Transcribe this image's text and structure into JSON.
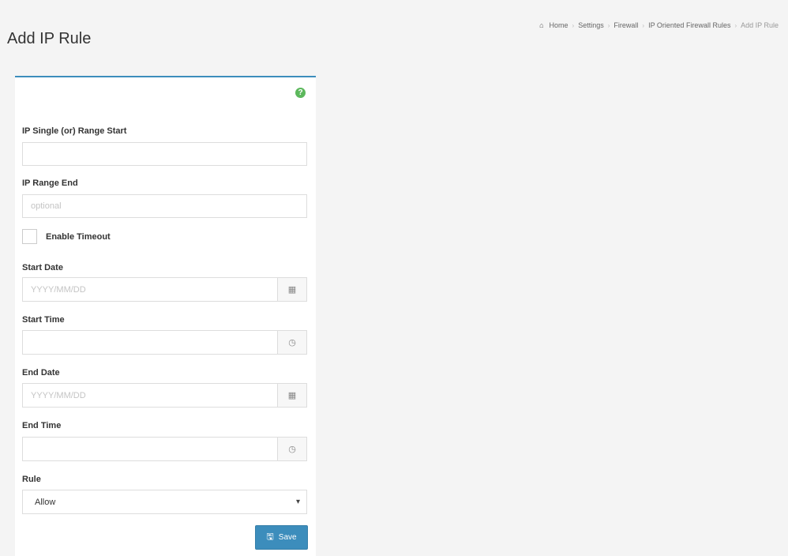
{
  "page": {
    "title": "Add IP Rule"
  },
  "breadcrumb": {
    "home_icon": "home-icon",
    "items": [
      "Home",
      "Settings",
      "Firewall",
      "IP Oriented Firewall Rules",
      "Add IP Rule"
    ],
    "separator": "›"
  },
  "form": {
    "help_icon": "question-circle-icon",
    "help_glyph": "?",
    "ip_start": {
      "label": "IP Single (or) Range Start",
      "value": "",
      "placeholder": ""
    },
    "ip_end": {
      "label": "IP Range End",
      "value": "",
      "placeholder": "optional"
    },
    "enable_timeout": {
      "label": "Enable Timeout",
      "checked": false
    },
    "start_date": {
      "label": "Start Date",
      "value": "",
      "placeholder": "YYYY/MM/DD",
      "icon": "calendar-icon",
      "glyph": "▦"
    },
    "start_time": {
      "label": "Start Time",
      "value": "",
      "placeholder": "",
      "icon": "clock-icon",
      "glyph": "◷"
    },
    "end_date": {
      "label": "End Date",
      "value": "",
      "placeholder": "YYYY/MM/DD",
      "icon": "calendar-icon",
      "glyph": "▦"
    },
    "end_time": {
      "label": "End Time",
      "value": "",
      "placeholder": "",
      "icon": "clock-icon",
      "glyph": "◷"
    },
    "rule": {
      "label": "Rule",
      "selected": "Allow",
      "chevron": "▾"
    },
    "save_button": {
      "label": "Save",
      "icon": "save-icon",
      "glyph": "🖫"
    }
  },
  "colors": {
    "primary": "#3c8dbc",
    "help": "#5cb85c",
    "background": "#f4f4f4"
  }
}
